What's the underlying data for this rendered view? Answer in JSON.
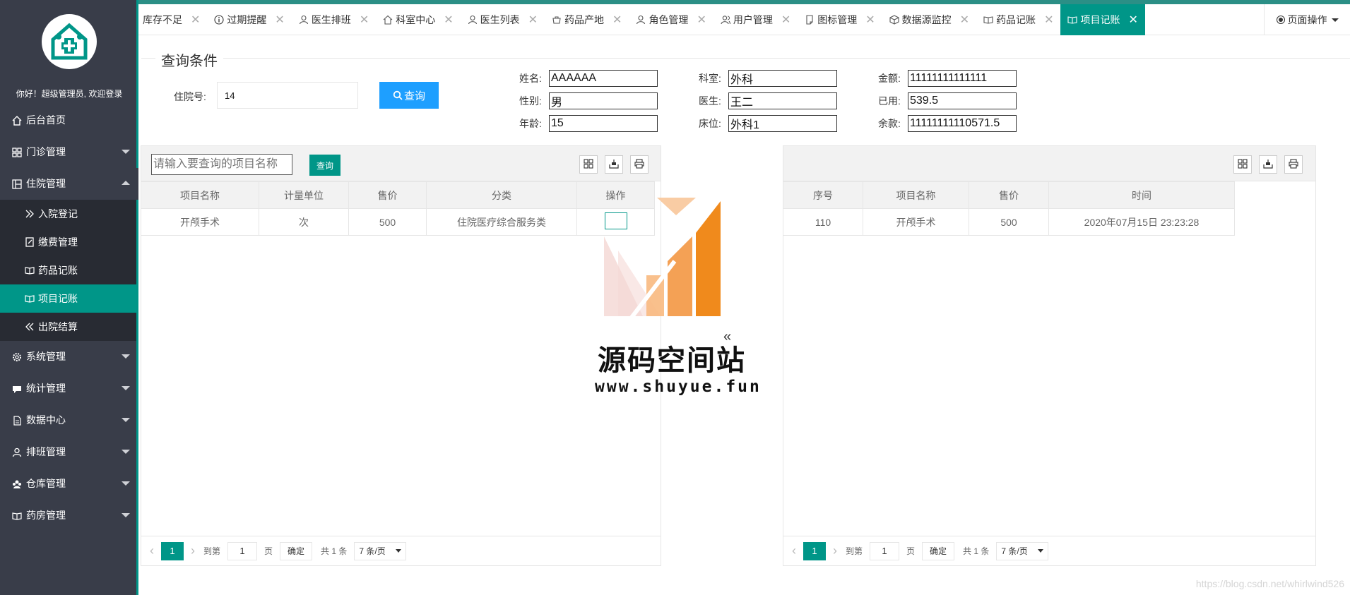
{
  "sidebar": {
    "welcome": "你好！超级管理员, 欢迎登录",
    "items": [
      {
        "label": "后台首页",
        "icon": "home-icon"
      },
      {
        "label": "门诊管理",
        "icon": "apps-icon"
      },
      {
        "label": "住院管理",
        "icon": "columns-icon"
      },
      {
        "label": "系统管理",
        "icon": "gear-icon"
      },
      {
        "label": "统计管理",
        "icon": "chat-icon"
      },
      {
        "label": "数据中心",
        "icon": "file-icon"
      },
      {
        "label": "排班管理",
        "icon": "user-icon"
      },
      {
        "label": "仓库管理",
        "icon": "group-icon"
      },
      {
        "label": "药房管理",
        "icon": "read-icon"
      }
    ],
    "sub_items": [
      {
        "label": "入院登记",
        "icon": "double-right-icon"
      },
      {
        "label": "缴费管理",
        "icon": "form-icon"
      },
      {
        "label": "药品记账",
        "icon": "read-icon"
      },
      {
        "label": "项目记账",
        "icon": "read-icon"
      },
      {
        "label": "出院结算",
        "icon": "double-left-icon"
      }
    ]
  },
  "tabs": [
    {
      "label": "库存不足",
      "icon": ""
    },
    {
      "label": "过期提醒",
      "icon": "info-icon"
    },
    {
      "label": "医生排班",
      "icon": "user-icon"
    },
    {
      "label": "科室中心",
      "icon": "home-icon"
    },
    {
      "label": "医生列表",
      "icon": "user-icon"
    },
    {
      "label": "药品产地",
      "icon": "component-icon"
    },
    {
      "label": "角色管理",
      "icon": "user-icon"
    },
    {
      "label": "用户管理",
      "icon": "group-icon"
    },
    {
      "label": "图标管理",
      "icon": "note-icon"
    },
    {
      "label": "数据源监控",
      "icon": "cube-icon"
    },
    {
      "label": "药品记账",
      "icon": "read-icon"
    },
    {
      "label": "项目记账",
      "icon": "read-icon"
    }
  ],
  "tab_close_glyph": "✕",
  "page_ops_label": "页面操作",
  "query": {
    "legend": "查询条件",
    "inpatient_no_label": "住院号:",
    "inpatient_no_value": "14",
    "search_button": "查询",
    "fields": {
      "name_label": "姓名:",
      "name_value": "AAAAAA",
      "gender_label": "性别:",
      "gender_value": "男",
      "age_label": "年龄:",
      "age_value": "15",
      "dept_label": "科室:",
      "dept_value": "外科",
      "doctor_label": "医生:",
      "doctor_value": "王二",
      "bed_label": "床位:",
      "bed_value": "外科1",
      "amount_label": "金额:",
      "amount_value": "11111111111111",
      "used_label": "已用:",
      "used_value": "539.5",
      "balance_label": "余款:",
      "balance_value": "11111111110571.5"
    }
  },
  "left_table": {
    "search_placeholder": "请输入要查询的项目名称",
    "search_button": "查询",
    "columns": [
      "项目名称",
      "计量单位",
      "售价",
      "分类",
      "操作"
    ],
    "rows": [
      [
        "开颅手术",
        "次",
        "500",
        "住院医疗综合服务类"
      ]
    ]
  },
  "right_table": {
    "columns": [
      "序号",
      "项目名称",
      "售价",
      "时间"
    ],
    "rows": [
      [
        "110",
        "开颅手术",
        "500",
        "2020年07月15日 23:23:28"
      ]
    ]
  },
  "pager": {
    "current_page": "1",
    "goto_label": "到第",
    "goto_value": "1",
    "page_unit": "页",
    "confirm": "确定",
    "total": "共 1 条",
    "per_page": "7 条/页"
  },
  "watermark": {
    "title": "源码空间站",
    "url": "www.shuyue.fun",
    "glyph": "«"
  },
  "footer_watermark": "https://blog.csdn.net/whirlwind526",
  "colors": {
    "sidebar_bg": "#393d49",
    "submenu_bg": "#282b33",
    "accent": "#009688",
    "primary_blue": "#1e9fff",
    "watermark_orange": "#f08a1c"
  }
}
